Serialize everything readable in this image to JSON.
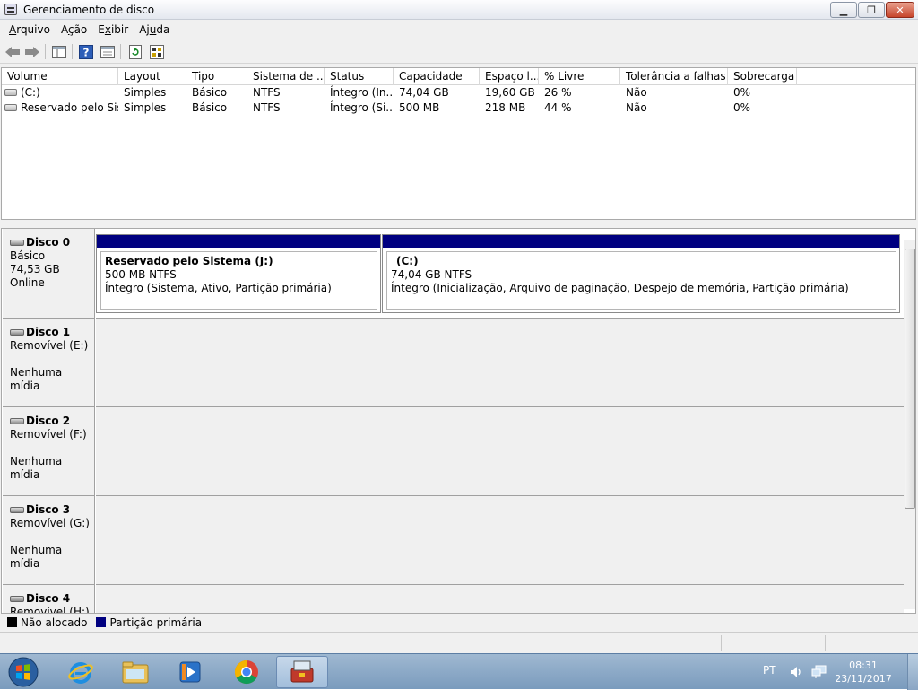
{
  "window": {
    "title": "Gerenciamento de disco",
    "minimize": "▁",
    "maximize": "❐",
    "close": "✕"
  },
  "menu": [
    {
      "pre": "",
      "key": "A",
      "post": "rquivo"
    },
    {
      "pre": "A",
      "key": "ç",
      "post": "ão"
    },
    {
      "pre": "E",
      "key": "x",
      "post": "ibir"
    },
    {
      "pre": "Aj",
      "key": "u",
      "post": "da"
    }
  ],
  "columns": [
    "Volume",
    "Layout",
    "Tipo",
    "Sistema de ...",
    "Status",
    "Capacidade",
    "Espaço l...",
    "% Livre",
    "Tolerância a falhas",
    "Sobrecarga"
  ],
  "volumes": [
    {
      "volume": "(C:)",
      "layout": "Simples",
      "tipo": "Básico",
      "fs": "NTFS",
      "status": "Íntegro (In...",
      "capacidade": "74,04 GB",
      "livre": "19,60 GB",
      "pct": "26 %",
      "tolerancia": "Não",
      "sobrecarga": "0%"
    },
    {
      "volume": "Reservado pelo Sis...",
      "layout": "Simples",
      "tipo": "Básico",
      "fs": "NTFS",
      "status": "Íntegro (Si...",
      "capacidade": "500 MB",
      "livre": "218 MB",
      "pct": "44 %",
      "tolerancia": "Não",
      "sobrecarga": "0%"
    }
  ],
  "disks": [
    {
      "name": "Disco 0",
      "l1": "Básico",
      "l2": "74,53 GB",
      "l3": "Online"
    },
    {
      "name": "Disco 1",
      "l1": "Removível (E:)",
      "l2": "",
      "l3": "Nenhuma mídia"
    },
    {
      "name": "Disco 2",
      "l1": "Removível (F:)",
      "l2": "",
      "l3": "Nenhuma mídia"
    },
    {
      "name": "Disco 3",
      "l1": "Removível (G:)",
      "l2": "",
      "l3": "Nenhuma mídia"
    },
    {
      "name": "Disco 4",
      "l1": "Removível (H:)",
      "l2": "",
      "l3": ""
    }
  ],
  "partitions": [
    {
      "title": "Reservado pelo Sistema  (J:)",
      "size": "500 MB NTFS",
      "status": "Íntegro (Sistema, Ativo, Partição primária)"
    },
    {
      "title": "(C:)",
      "size": "74,04 GB NTFS",
      "status": "Íntegro (Inicialização, Arquivo de paginação, Despejo de memória, Partição primária)"
    }
  ],
  "legend": [
    {
      "label": "Não alocado",
      "color": "#000000"
    },
    {
      "label": "Partição primária",
      "color": "#000080"
    }
  ],
  "tray": {
    "lang": "PT",
    "time": "08:31",
    "date": "23/11/2017"
  }
}
